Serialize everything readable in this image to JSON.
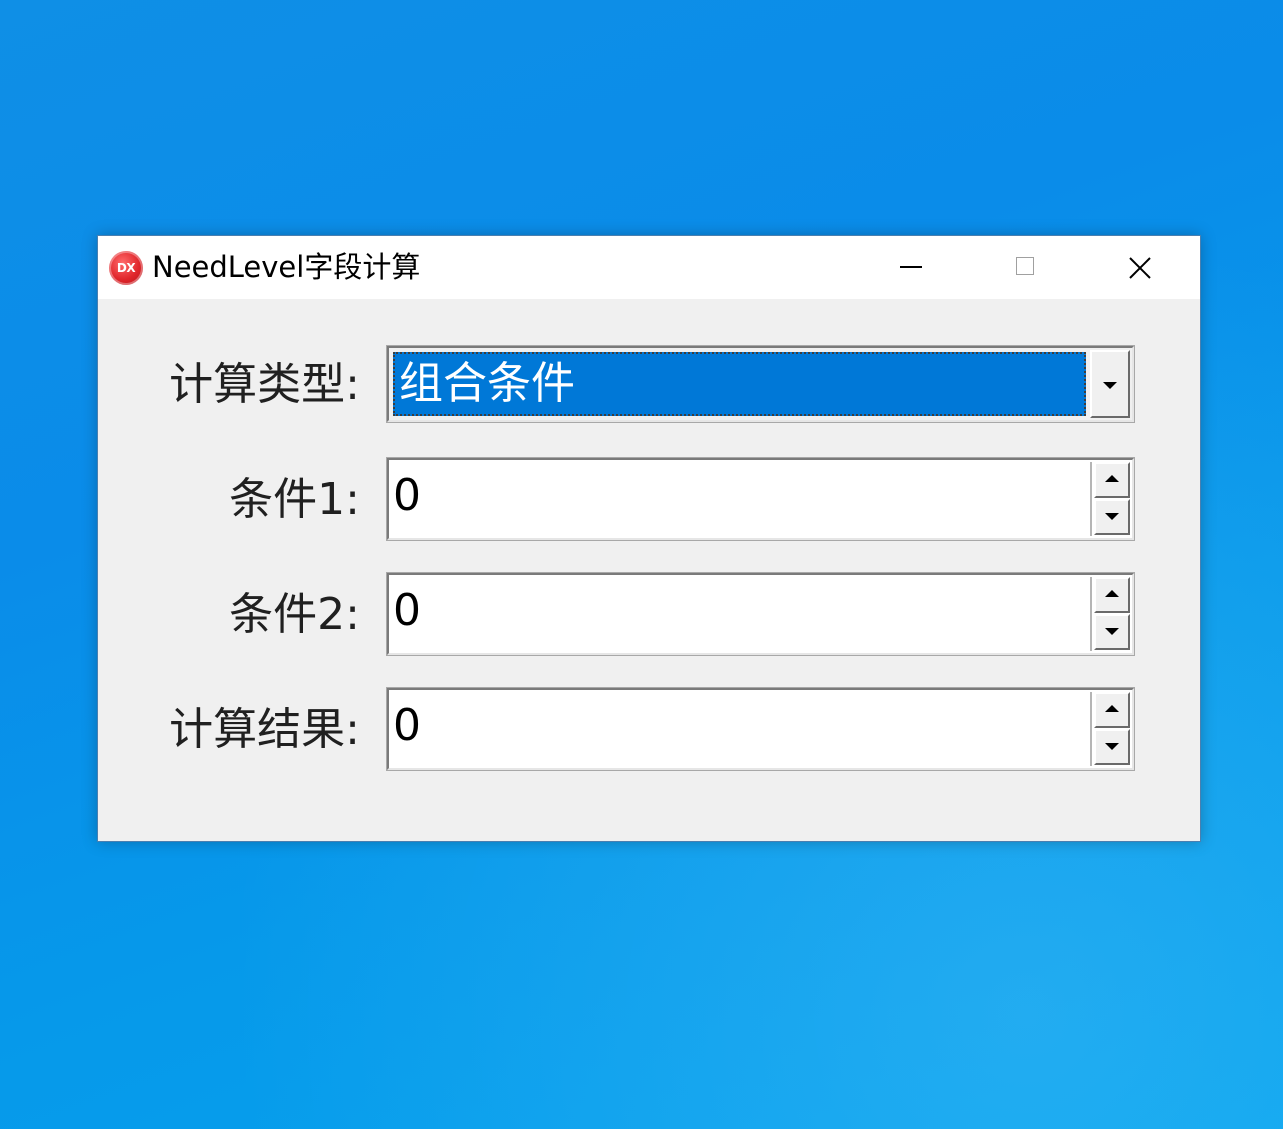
{
  "window": {
    "title": "NeedLevel字段计算",
    "app_icon_text": "DX",
    "icons": {
      "app": "dx-logo-icon",
      "minimize": "minimize-icon",
      "maximize": "maximize-icon",
      "close": "close-icon"
    }
  },
  "form": {
    "calc_type": {
      "label": "计算类型:",
      "selected": "组合条件"
    },
    "condition1": {
      "label": "条件1:",
      "value": "0"
    },
    "condition2": {
      "label": "条件2:",
      "value": "0"
    },
    "result": {
      "label": "计算结果:",
      "value": "0"
    }
  },
  "colors": {
    "desktop": "#0a8ce9",
    "selection": "#0078d7",
    "dialog_bg": "#f0f0f0",
    "app_icon": "#e0262b"
  }
}
